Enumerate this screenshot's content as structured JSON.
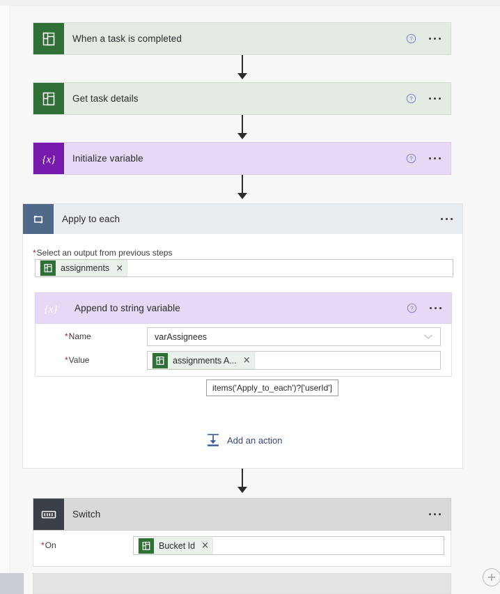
{
  "canvas": {
    "background_color": "#f7f7f7",
    "zoom_in_label": "+"
  },
  "steps": [
    {
      "id": "trigger",
      "title": "When a task is completed",
      "connector": "planner",
      "icon": "planner-icon",
      "help_icon": "help-icon",
      "menu_icon": "ellipsis-icon"
    },
    {
      "id": "get-task-details",
      "title": "Get task details",
      "connector": "planner",
      "icon": "planner-icon",
      "help_icon": "help-icon",
      "menu_icon": "ellipsis-icon"
    },
    {
      "id": "initialize-variable",
      "title": "Initialize variable",
      "connector": "variable",
      "icon": "variable-braces-icon",
      "help_icon": "help-icon",
      "menu_icon": "ellipsis-icon"
    }
  ],
  "apply_to_each": {
    "title": "Apply to each",
    "icon": "loop-icon",
    "menu_icon": "ellipsis-icon",
    "output_field": {
      "label": "Select an output from previous steps",
      "required_marker": "*",
      "token": {
        "label": "assignments",
        "icon": "planner-icon",
        "remove_label": "×"
      }
    },
    "inner_action": {
      "title": "Append to string variable",
      "icon": "variable-braces-icon",
      "help_icon": "help-icon",
      "menu_icon": "ellipsis-icon",
      "fields": [
        {
          "label": "Name",
          "required_marker": "*",
          "value": "varAssignees",
          "control": "dropdown",
          "chevron_icon": "chevron-down-icon"
        },
        {
          "label": "Value",
          "required_marker": "*",
          "token": {
            "label": "assignments A...",
            "icon": "planner-icon",
            "remove_label": "×"
          }
        }
      ]
    },
    "tooltip": {
      "text": "items('Apply_to_each')?['userId']"
    },
    "add_action": {
      "label": "Add an action",
      "icon": "insert-action-icon"
    }
  },
  "switch": {
    "title": "Switch",
    "icon": "switch-icon",
    "menu_icon": "ellipsis-icon",
    "on_field": {
      "label": "On",
      "required_marker": "*",
      "token": {
        "label": "Bucket Id",
        "icon": "planner-icon",
        "remove_label": "×"
      }
    }
  },
  "colors": {
    "planner_green": "#2e7035",
    "planner_card_bg": "#e3ebe3",
    "variable_purple": "#7719aa",
    "variable_card_bg": "#e6d9f5",
    "loop_blue": "#50688a",
    "loop_header_bg": "#e8ecf0",
    "switch_dark": "#3b4048",
    "switch_card_bg": "#d9d9d9",
    "link_blue": "#33477d",
    "required_red": "#a4262c"
  }
}
